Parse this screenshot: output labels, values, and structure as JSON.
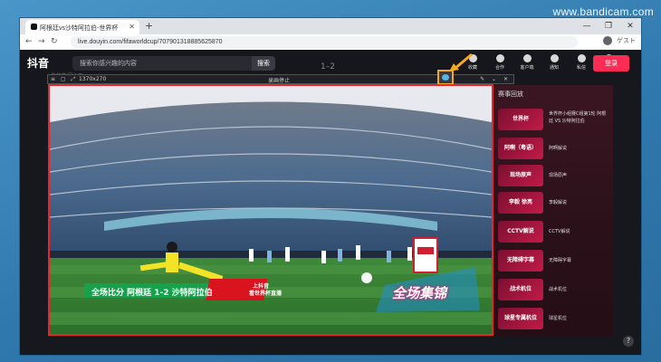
{
  "watermark": "www.bandicam.com",
  "browser": {
    "tab_title": "阿根廷vs沙特阿拉伯-世界杯",
    "tab_close": "✕",
    "new_tab": "+",
    "url": "live.douyin.com/fifaworldcup/7079013188856258​70",
    "window_controls": [
      "—",
      "❐",
      "✕"
    ],
    "account_label": "ゲスト",
    "nav": [
      "←",
      "→",
      "↻"
    ]
  },
  "douyin": {
    "logo": "抖音",
    "search_placeholder": "搜索你感兴趣的内容",
    "search_button": "搜索",
    "subline": "你的热门主页",
    "score_ghost": "1–2",
    "header_items": [
      "收藏",
      "合作",
      "客户端",
      "通知",
      "私信",
      "投稿"
    ],
    "login": "登录"
  },
  "capture": {
    "dimensions": "1370x270",
    "status": "录画停止"
  },
  "video": {
    "score_banner": "全场比分 阿根廷 1-2 沙特阿拉伯",
    "promo_line1": "上抖音",
    "promo_line2": "看世界杯直播",
    "highlight": "全场集锦"
  },
  "side_panel": {
    "title": "赛事回放",
    "items": [
      {
        "thumb": "世界杯",
        "label": "世界杯小组赛C组第1轮 阿根廷 VS 沙特阿拉伯"
      },
      {
        "thumb": "阿啊（粤语）",
        "label": "阿啊解说"
      },
      {
        "thumb": "现场原声",
        "label": "现场原声"
      },
      {
        "thumb": "李毅 徐亮",
        "label": "李毅解说"
      },
      {
        "thumb": "CCTV解说",
        "label": "CCTV解说"
      },
      {
        "thumb": "无障碍字幕",
        "label": "无障碍字幕"
      },
      {
        "thumb": "战术机位",
        "label": "战术机位"
      },
      {
        "thumb": "球星专属机位",
        "label": "球星机位"
      }
    ]
  },
  "help": "?"
}
